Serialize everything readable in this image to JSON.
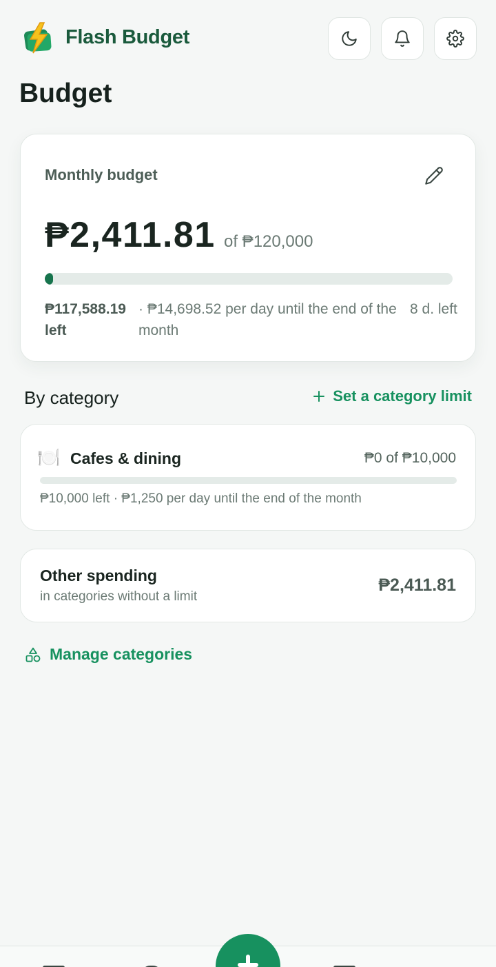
{
  "app": {
    "name": "Flash Budget"
  },
  "header": {
    "icons": [
      "moon-icon",
      "bell-icon",
      "gear-icon"
    ]
  },
  "page": {
    "title": "Budget"
  },
  "monthly_budget": {
    "label": "Monthly budget",
    "spent": "₱2,411.81",
    "of_total": "of ₱120,000",
    "progress_fraction": 0.02,
    "left": "₱117,588.19 left",
    "per_day": "· ₱14,698.52 per day until the end of the month",
    "days_left": "8 d. left"
  },
  "by_category": {
    "title": "By category",
    "set_limit_label": "Set a category limit",
    "categories": [
      {
        "emoji": "🍽️",
        "name": "Cafes & dining",
        "amount": "₱0 of ₱10,000",
        "progress_fraction": 0,
        "subtitle": "₱10,000 left · ₱1,250 per day until the end of the month"
      }
    ],
    "other": {
      "name": "Other spending",
      "subtitle": "in categories without a limit",
      "amount": "₱2,411.81"
    },
    "manage_label": "Manage categories"
  },
  "colors": {
    "accent": "#17915f",
    "brand": "#1a5a3c",
    "progress": "#17744d"
  }
}
